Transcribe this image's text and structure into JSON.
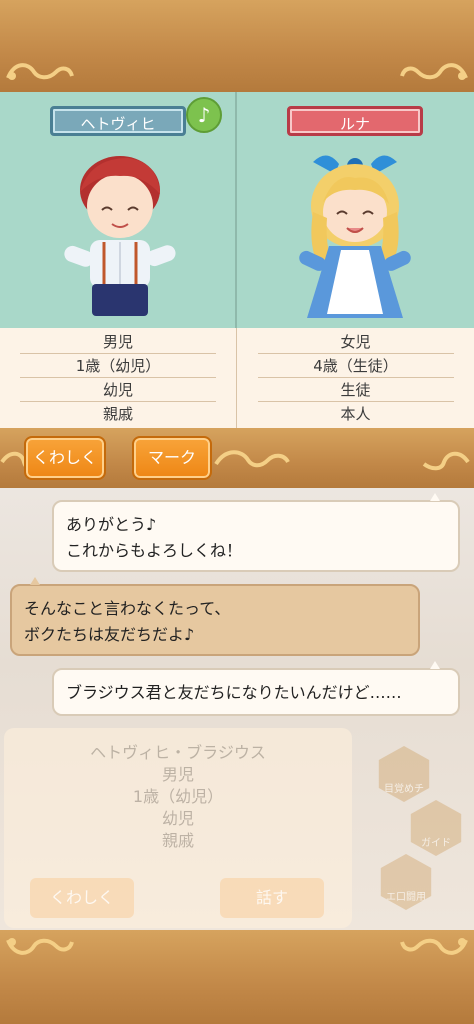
{
  "characters": [
    {
      "name": "ヘトヴィヒ",
      "info": [
        "男児",
        "1歳（幼児）",
        "幼児",
        "親戚"
      ]
    },
    {
      "name": "ルナ",
      "info": [
        "女児",
        "4歳（生徒）",
        "生徒",
        "本人"
      ]
    }
  ],
  "buttons": {
    "detail": "くわしく",
    "mark": "マーク"
  },
  "chat": [
    {
      "line1": "ありがとう♪",
      "line2": "これからもよろしくね！"
    },
    {
      "line1": "そんなこと言わなくたって、",
      "line2": "ボクたちは友だちだよ♪"
    },
    {
      "line1": "ブラジウス君と友だちになりたいんだけど……"
    }
  ],
  "background_card": {
    "full_name": "ヘトヴィヒ・ブラジウス",
    "info": [
      "男児",
      "1歳（幼児）",
      "幼児",
      "親戚"
    ],
    "detail_button": "くわしく",
    "talk_button": "話す"
  },
  "side_menu": {
    "items": [
      "目覚めチ",
      "ガイド",
      "エ口闘用"
    ]
  },
  "icons": {
    "music_note": "♪"
  },
  "colors": {
    "wood": "#c9934f",
    "panel_bg": "#a9d8c9",
    "accent_orange": "#f8a43a",
    "boy_tag": "#7aa8b9",
    "girl_tag": "#e3686e",
    "note_green": "#7dc24e"
  }
}
